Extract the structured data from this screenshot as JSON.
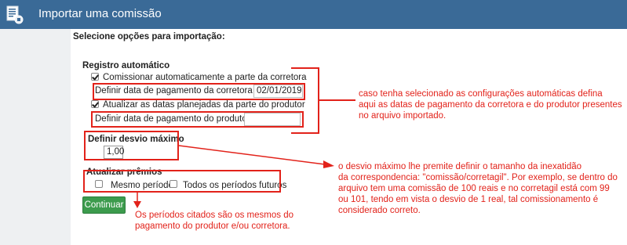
{
  "header": {
    "title": "Importar uma comissão",
    "icon": "document-import-icon",
    "background": "#3a6a97"
  },
  "instructions": "Selecione opções para importação:",
  "registro": {
    "title": "Registro automático",
    "commission_checkbox": {
      "label": "Comissionar automaticamente a parte da corretora",
      "checked": true
    },
    "broker_date": {
      "label": "Definir data de pagamento da corretora",
      "value": "02/01/2019"
    },
    "update_checkbox": {
      "label": "Atualizar as datas planejadas da parte do produtor",
      "checked": true
    },
    "producer_date": {
      "label": "Definir data de pagamento do produtor",
      "value": ""
    }
  },
  "desvio": {
    "title": "Definir desvio máximo",
    "value": "1,00"
  },
  "premios": {
    "title": "Atualizar prêmios",
    "same_period": {
      "label": "Mesmo período",
      "checked": false
    },
    "future_periods": {
      "label": "Todos os períodos futuros",
      "checked": false
    }
  },
  "continue_button": "Continuar",
  "annotations": {
    "note1_lines": [
      "caso tenha selecionado as configurações automáticas defina",
      "aqui as datas de pagamento da corretora e do produtor presentes",
      "no arquivo importado."
    ],
    "note2_lines": [
      "o desvio máximo lhe premite definir o tamanho da inexatidão",
      "da correspondencia:  \"comissão/corretagil\". Por exemplo, se dentro do",
      "arquivo tem uma comissão de 100 reais e no corretagil está com 99",
      "ou 101, tendo em vista o desvio de 1 real, tal comissionamento é",
      "considerado correto."
    ],
    "note3_lines": [
      "Os períodos citados são os mesmos do",
      "pagamento do produtor e/ou corretora."
    ],
    "color": "#e2221a"
  },
  "colors": {
    "accent_red": "#e2221a",
    "button_green": "#3c9b4d"
  }
}
